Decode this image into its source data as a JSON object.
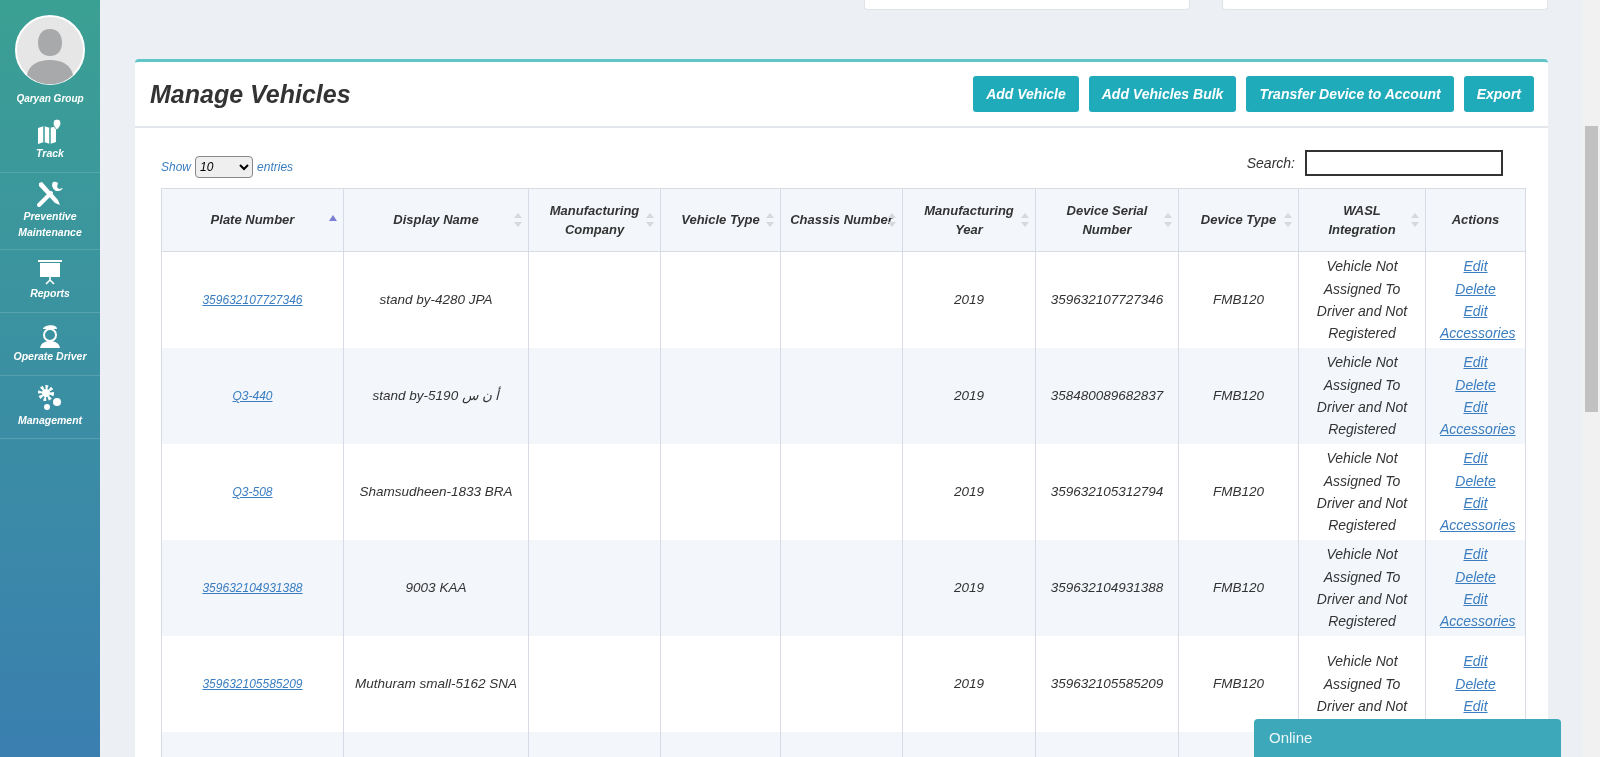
{
  "sidebar": {
    "user": "Qaryan Group",
    "items": [
      {
        "label": "Track"
      },
      {
        "label": "Preventive Maintenance"
      },
      {
        "label": "Reports"
      },
      {
        "label": "Operate Driver"
      },
      {
        "label": "Management"
      }
    ]
  },
  "page": {
    "title": "Manage Vehicles",
    "buttons": [
      "Add Vehicle",
      "Add Vehicles Bulk",
      "Transfer Device to Account",
      "Export"
    ]
  },
  "table_controls": {
    "show_label": "Show",
    "entries_value": "10",
    "entries_label": "entries",
    "search_label": "Search:"
  },
  "table": {
    "columns": [
      {
        "label": "Plate Number",
        "sortable": true,
        "sorted": true
      },
      {
        "label": "Display Name",
        "sortable": true,
        "sorted": false
      },
      {
        "label": "Manufacturing Company",
        "sortable": true,
        "sorted": false
      },
      {
        "label": "Vehicle Type",
        "sortable": true,
        "sorted": false
      },
      {
        "label": "Chassis Number",
        "sortable": true,
        "sorted": false
      },
      {
        "label": "Manufacturing Year",
        "sortable": true,
        "sorted": false
      },
      {
        "label": "Device Serial Number",
        "sortable": true,
        "sorted": false
      },
      {
        "label": "Device Type",
        "sortable": true,
        "sorted": false
      },
      {
        "label": "WASL Integration",
        "sortable": true,
        "sorted": false
      },
      {
        "label": "Actions",
        "sortable": false,
        "sorted": false
      }
    ],
    "rows": [
      {
        "plate": "359632107727346",
        "display_name": "stand by-4280 JPA",
        "year": "2019",
        "serial": "359632107727346",
        "device_type": "FMB120",
        "wasl": "Vehicle Not Assigned To Driver and Not Registered",
        "actions": [
          "Edit",
          "Delete",
          "Edit Accessories"
        ]
      },
      {
        "plate": "Q3-440",
        "display_name": "stand by-5190 أ ن س",
        "year": "2019",
        "serial": "358480089682837",
        "device_type": "FMB120",
        "wasl": "Vehicle Not Assigned To Driver and Not Registered",
        "actions": [
          "Edit",
          "Delete",
          "Edit Accessories"
        ]
      },
      {
        "plate": "Q3-508",
        "display_name": "Shamsudheen-1833 BRA",
        "year": "2019",
        "serial": "359632105312794",
        "device_type": "FMB120",
        "wasl": "Vehicle Not Assigned To Driver and Not Registered",
        "actions": [
          "Edit",
          "Delete",
          "Edit Accessories"
        ]
      },
      {
        "plate": "359632104931388",
        "display_name": "9003 KAA",
        "year": "2019",
        "serial": "359632104931388",
        "device_type": "FMB120",
        "wasl": "Vehicle Not Assigned To Driver and Not Registered",
        "actions": [
          "Edit",
          "Delete",
          "Edit Accessories"
        ]
      },
      {
        "plate": "359632105585209",
        "display_name": "Muthuram small-5162 SNA",
        "year": "2019",
        "serial": "359632105585209",
        "device_type": "FMB120",
        "wasl": "Vehicle Not Assigned To Driver and Not",
        "actions": [
          "Edit",
          "Delete",
          "Edit"
        ]
      }
    ]
  },
  "chat": {
    "label": "Online"
  }
}
